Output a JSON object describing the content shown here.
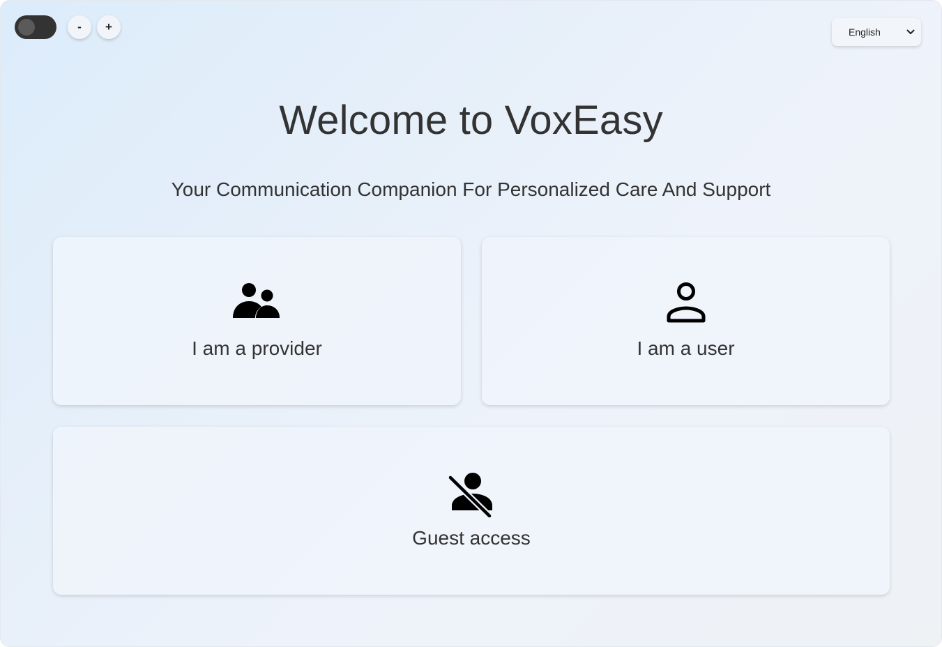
{
  "toolbar": {
    "theme_toggle_state": "off",
    "zoom_out_label": "-",
    "zoom_in_label": "+"
  },
  "language": {
    "selected": "English"
  },
  "header": {
    "title": "Welcome to VoxEasy",
    "subtitle": "Your Communication Companion For Personalized Care And Support"
  },
  "cards": [
    {
      "label": "I am a provider",
      "icon": "supervisor-account-icon"
    },
    {
      "label": "I am a user",
      "icon": "person-outline-icon"
    },
    {
      "label": "Guest access",
      "icon": "person-off-icon"
    }
  ]
}
